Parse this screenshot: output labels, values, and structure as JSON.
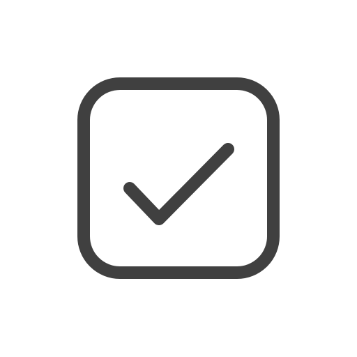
{
  "icon": {
    "name": "checkbox-checked-icon",
    "state": "checked",
    "stroke_color": "#404040",
    "background_color": "#ffffff"
  }
}
